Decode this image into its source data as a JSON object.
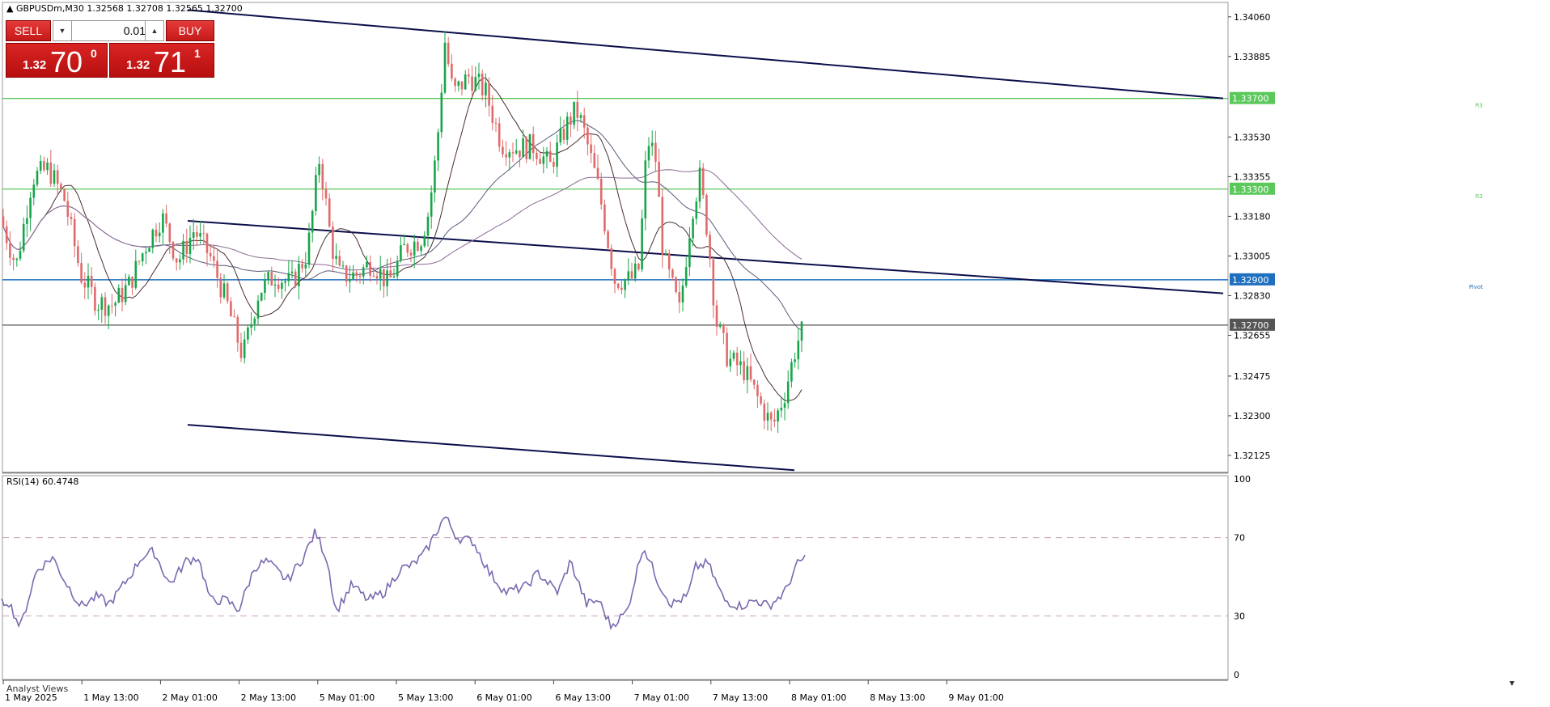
{
  "header": {
    "symbol_line": "▲ GBPUSDm,M30  1.32568 1.32708 1.32565 1.32700"
  },
  "trade_panel": {
    "sell_label": "SELL",
    "buy_label": "BUY",
    "lot": "0.01",
    "sell_quote": {
      "prefix": "1.32",
      "big": "70",
      "sup": "0"
    },
    "buy_quote": {
      "prefix": "1.32",
      "big": "71",
      "sup": "1"
    }
  },
  "price_axis": {
    "ticks": [
      "1.34060",
      "1.33885",
      "1.33530",
      "1.33355",
      "1.33180",
      "1.33005",
      "1.32830",
      "1.32655",
      "1.32475",
      "1.32300",
      "1.32125"
    ],
    "ymin": 1.3205,
    "ymax": 1.3412
  },
  "levels": [
    {
      "name": "R3",
      "tag": "1.33700",
      "price": 1.337,
      "color": "#5ac85a"
    },
    {
      "name": "R2",
      "tag": "1.33300",
      "price": 1.333,
      "color": "#5ac85a"
    },
    {
      "name": "Pivot",
      "tag": "1.32900",
      "price": 1.329,
      "color": "#1f6fbf"
    },
    {
      "name": "",
      "tag": "1.32700",
      "price": 1.327,
      "color": "#555555"
    }
  ],
  "rsi": {
    "label": "RSI(14) 60.4748",
    "ticks": [
      "100",
      "70",
      "30",
      "0"
    ],
    "levels": [
      70,
      30
    ]
  },
  "time_axis": [
    "1 May 2025",
    "1 May 13:00",
    "2 May 01:00",
    "2 May 13:00",
    "5 May 01:00",
    "5 May 13:00",
    "6 May 01:00",
    "6 May 13:00",
    "7 May 01:00",
    "7 May 13:00",
    "8 May 01:00",
    "8 May 13:00",
    "9 May 01:00"
  ],
  "analyst_tab": "Analyst Views",
  "colors": {
    "bull": "#18a54a",
    "bear": "#e06a6a",
    "channel": "#0b0f4a",
    "rsi_line": "#7b68b0"
  },
  "chart_data": {
    "type": "candlestick",
    "close_path": [
      [
        0,
        1.3318
      ],
      [
        20,
        1.3296
      ],
      [
        40,
        1.3335
      ],
      [
        60,
        1.3339
      ],
      [
        80,
        1.3325
      ],
      [
        100,
        1.3292
      ],
      [
        120,
        1.328
      ],
      [
        140,
        1.3279
      ],
      [
        160,
        1.3288
      ],
      [
        180,
        1.3305
      ],
      [
        200,
        1.3318
      ],
      [
        220,
        1.3298
      ],
      [
        240,
        1.3312
      ],
      [
        260,
        1.33
      ],
      [
        280,
        1.328
      ],
      [
        300,
        1.3256
      ],
      [
        320,
        1.3285
      ],
      [
        340,
        1.3292
      ],
      [
        360,
        1.3288
      ],
      [
        380,
        1.3302
      ],
      [
        395,
        1.3344
      ],
      [
        410,
        1.3305
      ],
      [
        420,
        1.3292
      ],
      [
        440,
        1.3292
      ],
      [
        460,
        1.3298
      ],
      [
        480,
        1.3288
      ],
      [
        500,
        1.3304
      ],
      [
        520,
        1.3308
      ],
      [
        530,
        1.332
      ],
      [
        540,
        1.3348
      ],
      [
        550,
        1.3395
      ],
      [
        560,
        1.3372
      ],
      [
        580,
        1.338
      ],
      [
        600,
        1.3373
      ],
      [
        620,
        1.335
      ],
      [
        640,
        1.3348
      ],
      [
        660,
        1.3349
      ],
      [
        680,
        1.334
      ],
      [
        700,
        1.3358
      ],
      [
        712,
        1.3365
      ],
      [
        720,
        1.3358
      ],
      [
        740,
        1.333
      ],
      [
        750,
        1.331
      ],
      [
        760,
        1.329
      ],
      [
        780,
        1.329
      ],
      [
        790,
        1.3295
      ],
      [
        800,
        1.3352
      ],
      [
        810,
        1.3345
      ],
      [
        820,
        1.33
      ],
      [
        840,
        1.3276
      ],
      [
        855,
        1.332
      ],
      [
        865,
        1.3335
      ],
      [
        875,
        1.331
      ],
      [
        885,
        1.3272
      ],
      [
        900,
        1.3255
      ],
      [
        920,
        1.325
      ],
      [
        940,
        1.3235
      ],
      [
        955,
        1.3225
      ],
      [
        970,
        1.324
      ],
      [
        985,
        1.3262
      ],
      [
        995,
        1.327
      ]
    ],
    "channel": {
      "upper": {
        "from": [
          1.3409,
          232
        ],
        "to": [
          1.337,
          1512
        ]
      },
      "middle": {
        "from": [
          1.3316,
          232
        ],
        "to": [
          1.3284,
          1512
        ]
      },
      "lower": {
        "from": [
          1.3226,
          232
        ],
        "to": [
          1.3206,
          982
        ]
      }
    },
    "rsi_path": [
      [
        0,
        36
      ],
      [
        10,
        38
      ],
      [
        25,
        24
      ],
      [
        45,
        53
      ],
      [
        65,
        60
      ],
      [
        80,
        48
      ],
      [
        100,
        35
      ],
      [
        120,
        40
      ],
      [
        135,
        36
      ],
      [
        160,
        50
      ],
      [
        175,
        60
      ],
      [
        190,
        63
      ],
      [
        210,
        46
      ],
      [
        230,
        58
      ],
      [
        245,
        60
      ],
      [
        260,
        38
      ],
      [
        280,
        38
      ],
      [
        295,
        33
      ],
      [
        315,
        55
      ],
      [
        330,
        58
      ],
      [
        355,
        48
      ],
      [
        375,
        60
      ],
      [
        390,
        73
      ],
      [
        405,
        58
      ],
      [
        415,
        32
      ],
      [
        435,
        46
      ],
      [
        455,
        38
      ],
      [
        475,
        42
      ],
      [
        495,
        54
      ],
      [
        510,
        56
      ],
      [
        525,
        62
      ],
      [
        550,
        81
      ],
      [
        565,
        70
      ],
      [
        585,
        68
      ],
      [
        605,
        52
      ],
      [
        625,
        42
      ],
      [
        650,
        45
      ],
      [
        665,
        52
      ],
      [
        690,
        42
      ],
      [
        705,
        58
      ],
      [
        725,
        36
      ],
      [
        740,
        38
      ],
      [
        755,
        25
      ],
      [
        775,
        32
      ],
      [
        795,
        66
      ],
      [
        815,
        46
      ],
      [
        830,
        36
      ],
      [
        850,
        40
      ],
      [
        860,
        55
      ],
      [
        875,
        57
      ],
      [
        895,
        38
      ],
      [
        915,
        35
      ],
      [
        935,
        38
      ],
      [
        950,
        35
      ],
      [
        970,
        42
      ],
      [
        985,
        56
      ],
      [
        995,
        60
      ]
    ]
  }
}
